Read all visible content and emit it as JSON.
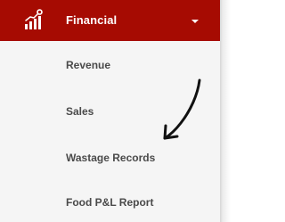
{
  "sidebar": {
    "header": {
      "icon": "financial-chart-icon",
      "title": "Financial",
      "toggle_icon": "caret-down-icon"
    },
    "items": [
      {
        "label": "Revenue"
      },
      {
        "label": "Sales"
      },
      {
        "label": "Wastage Records"
      },
      {
        "label": "Food P&L Report"
      }
    ]
  },
  "annotation": {
    "icon": "hand-drawn-arrow-icon"
  },
  "colors": {
    "header_bg": "#a60b02",
    "header_text": "#ffffff",
    "menu_bg": "#f5f5f5",
    "menu_text": "#4a4a4a",
    "arrow": "#111111"
  }
}
